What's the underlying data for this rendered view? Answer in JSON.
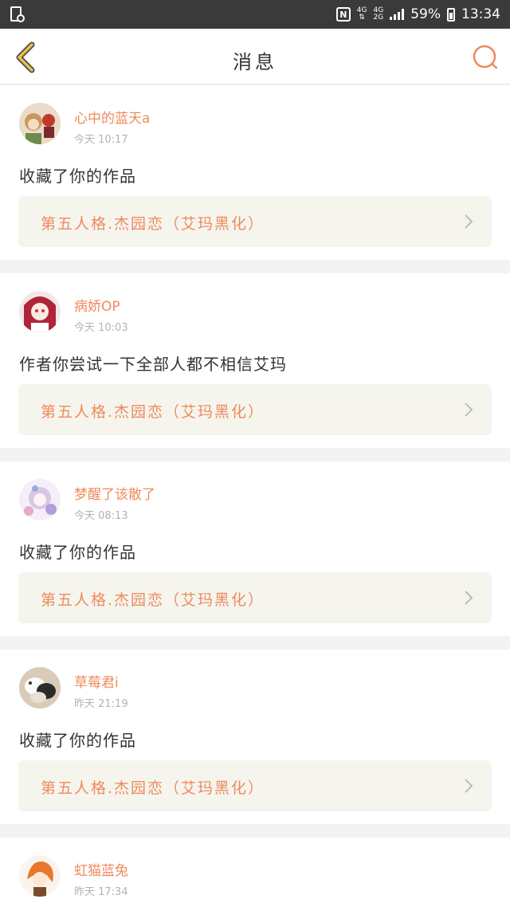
{
  "statusbar": {
    "time": "13:34",
    "battery": "59%",
    "net_top": "4G",
    "net_bottom": "2G",
    "nfc": "N"
  },
  "header": {
    "title": "消息"
  },
  "messages": [
    {
      "username": "心中的蓝天a",
      "time": "今天 10:17",
      "text": "收藏了你的作品",
      "work_title": "第五人格.杰园恋（艾玛黑化）"
    },
    {
      "username": "病娇OP",
      "time": "今天 10:03",
      "text": "作者你尝试一下全部人都不相信艾玛",
      "work_title": "第五人格.杰园恋（艾玛黑化）"
    },
    {
      "username": "梦醒了该散了",
      "time": "今天 08:13",
      "text": "收藏了你的作品",
      "work_title": "第五人格.杰园恋（艾玛黑化）"
    },
    {
      "username": "草莓君i",
      "time": "昨天 21:19",
      "text": "收藏了你的作品",
      "work_title": "第五人格.杰园恋（艾玛黑化）"
    },
    {
      "username": "虹猫蓝兔",
      "time": "昨天 17:34"
    }
  ],
  "colors": {
    "accent": "#f08a5d",
    "back_icon": "#e8c24a",
    "work_bg": "#f5f5ee",
    "statusbar": "#3a3a3a"
  },
  "icons": {
    "back": "chevron-left-icon",
    "search": "search-icon",
    "arrow": "chevron-right-icon"
  }
}
